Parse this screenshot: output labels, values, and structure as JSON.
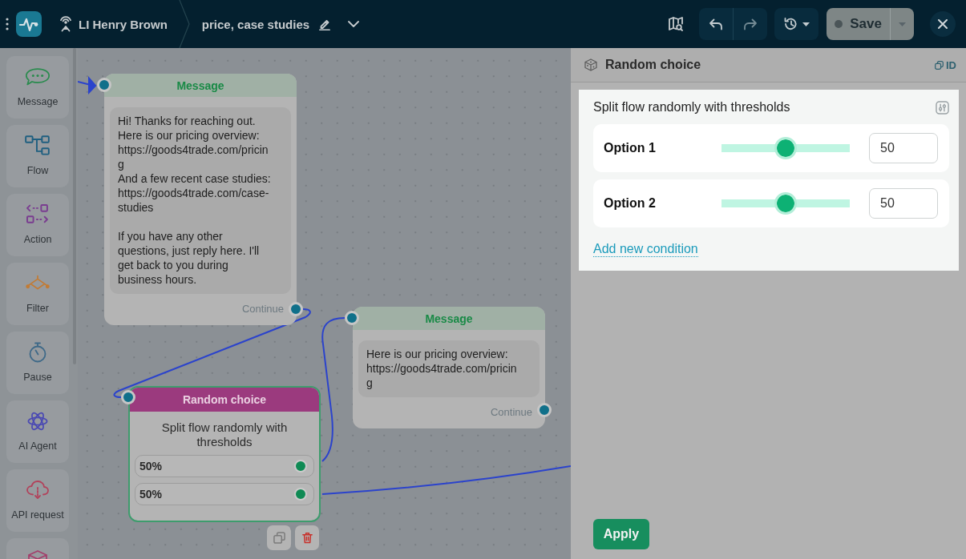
{
  "topbar": {
    "bot_name": "LI Henry Brown",
    "flow_name": "price, case studies",
    "undo": {
      "disabled": false
    },
    "redo": {
      "disabled": true
    },
    "save": {
      "label": "Save",
      "disabled": true
    }
  },
  "sidebar": {
    "items": [
      {
        "kind": "message",
        "label": "Message"
      },
      {
        "kind": "flow",
        "label": "Flow"
      },
      {
        "kind": "action",
        "label": "Action"
      },
      {
        "kind": "filter",
        "label": "Filter"
      },
      {
        "kind": "pause",
        "label": "Pause"
      },
      {
        "kind": "ai_agent",
        "label": "AI Agent"
      },
      {
        "kind": "api_request",
        "label": "API request"
      },
      {
        "kind": "box"
      }
    ]
  },
  "canvas": {
    "nodes": [
      {
        "kind": "message",
        "title": "Message",
        "text": "Hi! Thanks for reaching out.\nHere is our pricing overview: https://goods4trade.com/pricing\nAnd a few recent case studies: https://goods4trade.com/case-studies\n\nIf you have any other questions, just reply here. I'll get back to you during business hours.",
        "continue_label": "Continue",
        "selected": false
      },
      {
        "kind": "message",
        "title": "Message",
        "text": "Here is our pricing overview: https://goods4trade.com/pricing",
        "continue_label": "Continue",
        "selected": false
      },
      {
        "kind": "random_choice",
        "title": "Random choice",
        "description": "Split flow randomly with thresholds",
        "outputs": [
          "50%",
          "50%"
        ],
        "selected": true
      }
    ]
  },
  "panel": {
    "title": "Random choice",
    "id_label": "ID",
    "description": "Split flow randomly with thresholds",
    "options": [
      {
        "label": "Option 1",
        "level": 0.5,
        "value": "50"
      },
      {
        "label": "Option 2",
        "level": 0.5,
        "value": "50"
      }
    ],
    "add_link": "Add new condition",
    "apply_label": "Apply"
  }
}
